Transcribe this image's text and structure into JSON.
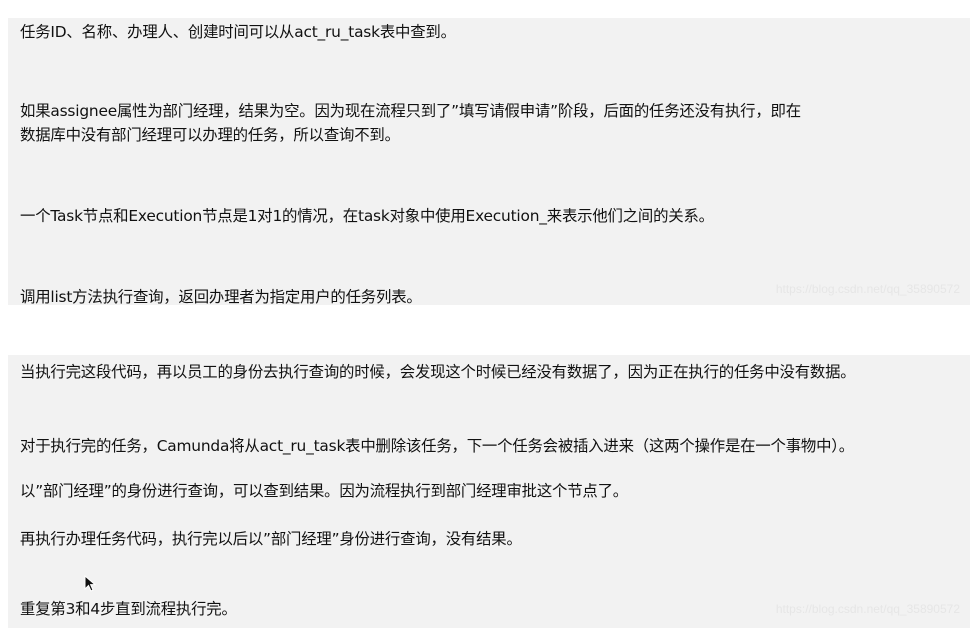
{
  "panel1": {
    "lines": [
      "任务ID、名称、办理人、创建时间可以从act_ru_task表中查到。",
      "如果assignee属性为部门经理，结果为空。因为现在流程只到了”填写请假申请”阶段，后面的任务还没有执行，即在",
      "数据库中没有部门经理可以办理的任务，所以查询不到。",
      "一个Task节点和Execution节点是1对1的情况，在task对象中使用Execution_来表示他们之间的关系。",
      "调用list方法执行查询，返回办理者为指定用户的任务列表。"
    ],
    "watermark": "https://blog.csdn.net/qq_35890572"
  },
  "panel2": {
    "lines": [
      "当执行完这段代码，再以员工的身份去执行查询的时候，会发现这个时候已经没有数据了，因为正在执行的任务中没有数据。",
      "对于执行完的任务，Camunda将从act_ru_task表中删除该任务，下一个任务会被插入进来（这两个操作是在一个事物中）。",
      "以”部门经理”的身份进行查询，可以查到结果。因为流程执行到部门经理审批这个节点了。",
      "再执行办理任务代码，执行完以后以”部门经理”身份进行查询，没有结果。",
      "重复第3和4步直到流程执行完。"
    ],
    "watermark": "https://blog.csdn.net/qq_35890572"
  }
}
